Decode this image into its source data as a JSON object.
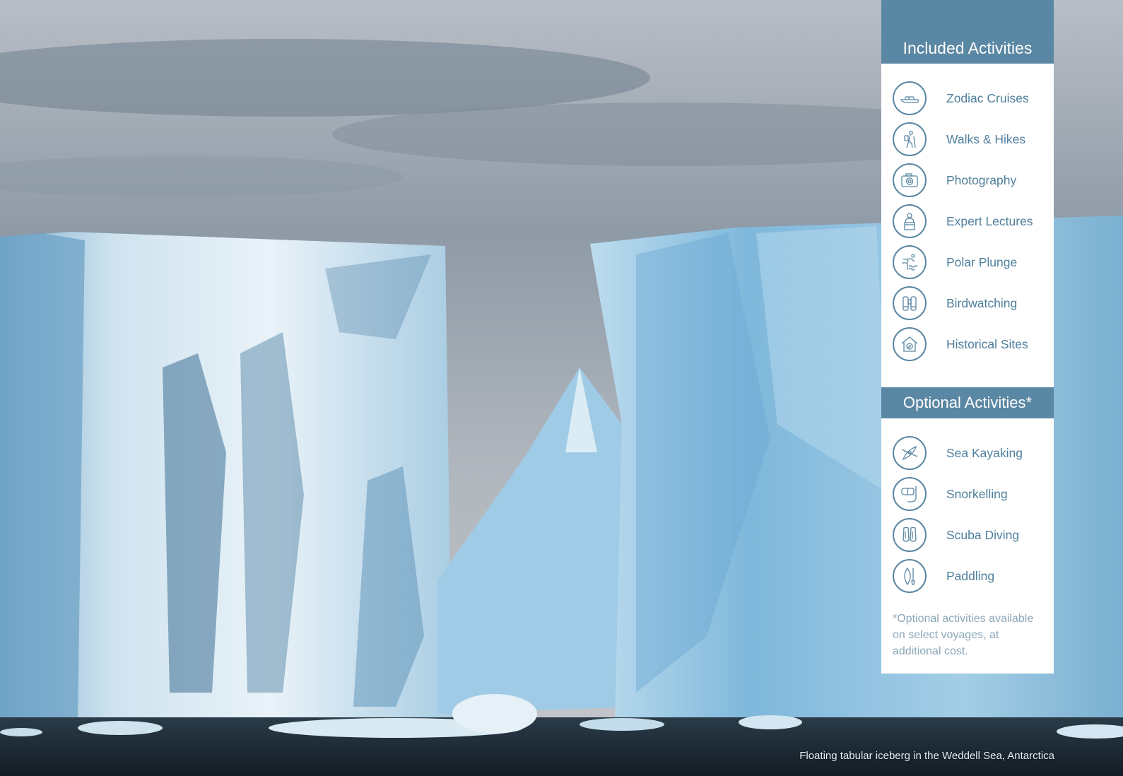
{
  "included": {
    "title": "Included Activities",
    "items": [
      {
        "label": "Zodiac Cruises",
        "icon": "zodiac-boat-icon"
      },
      {
        "label": "Walks & Hikes",
        "icon": "hiker-icon"
      },
      {
        "label": "Photography",
        "icon": "camera-icon"
      },
      {
        "label": "Expert Lectures",
        "icon": "lecturer-icon"
      },
      {
        "label": "Polar Plunge",
        "icon": "diver-plunge-icon"
      },
      {
        "label": "Birdwatching",
        "icon": "binoculars-icon"
      },
      {
        "label": "Historical Sites",
        "icon": "historic-house-icon"
      }
    ]
  },
  "optional": {
    "title": "Optional Activities*",
    "items": [
      {
        "label": "Sea Kayaking",
        "icon": "kayak-icon"
      },
      {
        "label": "Snorkelling",
        "icon": "snorkel-mask-icon"
      },
      {
        "label": "Scuba Diving",
        "icon": "fins-icon"
      },
      {
        "label": "Paddling",
        "icon": "paddle-board-icon"
      }
    ],
    "footnote": "*Optional activities available on select voyages, at additional cost."
  },
  "caption": "Floating tabular iceberg in the Weddell Sea, Antarctica",
  "colors": {
    "accent": "#5a87a3",
    "label": "#4f7f9c",
    "footnote": "#8aa7ba"
  }
}
